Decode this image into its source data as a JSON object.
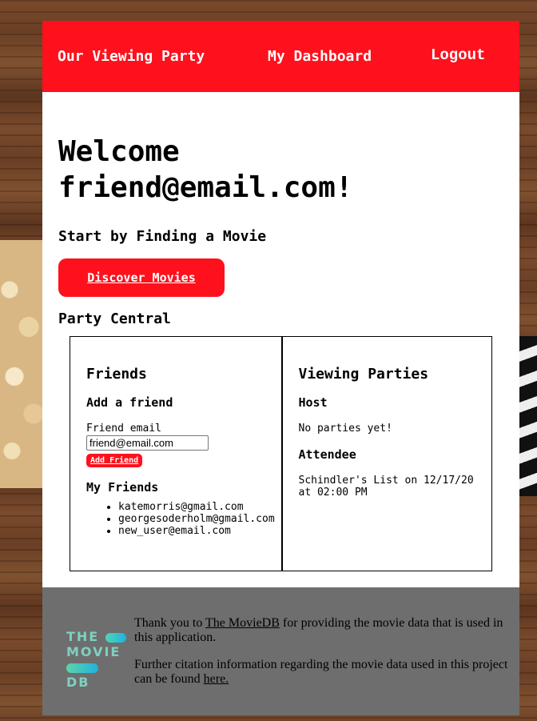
{
  "nav": {
    "party": "Our Viewing Party",
    "dashboard": "My Dashboard",
    "logout": "Logout"
  },
  "welcome": {
    "line1": "Welcome",
    "line2": "friend@email.com!"
  },
  "find_heading": "Start by Finding a Movie",
  "discover_button": "Discover Movies",
  "party_central": "Party Central",
  "friends_panel": {
    "title": "Friends",
    "add_heading": "Add a friend",
    "email_label": "Friend email",
    "email_value": "friend@email.com",
    "add_button": "Add Friend",
    "my_friends_heading": "My Friends",
    "friends": [
      "katemorris@gmail.com",
      "georgesoderholm@gmail.com",
      "new_user@email.com"
    ]
  },
  "parties_panel": {
    "title": "Viewing Parties",
    "host_heading": "Host",
    "host_empty": "No parties yet!",
    "attendee_heading": "Attendee",
    "attendee_item": "Schindler's List on 12/17/20 at 02:00 PM"
  },
  "footer": {
    "logo_line1": "THE",
    "logo_line2": "MOVIE",
    "logo_line3": "DB",
    "thanks_prefix": "Thank you to ",
    "thanks_link": "The MovieDB",
    "thanks_suffix": " for providing the movie data that is used in this application.",
    "citation_prefix": "Further citation information regarding the movie data used in this project can be found ",
    "citation_link": "here."
  },
  "colors": {
    "accent": "#fe111d",
    "footer_bg": "#6e6e6e"
  }
}
